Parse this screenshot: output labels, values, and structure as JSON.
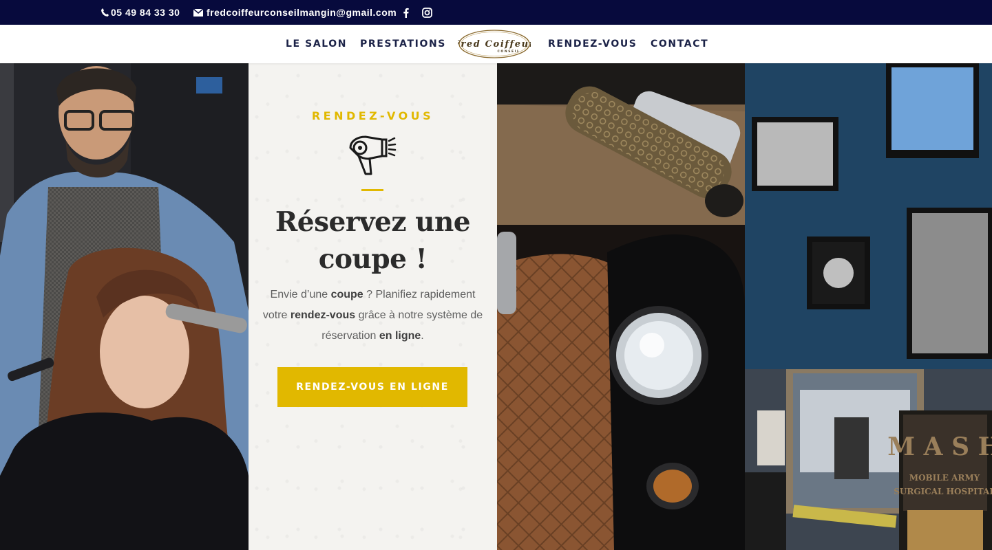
{
  "topbar": {
    "phone": "05 49 84 33 30",
    "email": "fredcoiffeurconseilmangin@gmail.com"
  },
  "nav": {
    "items": [
      {
        "label": "LE SALON"
      },
      {
        "label": "PRESTATIONS"
      },
      {
        "label": "RENDEZ-VOUS"
      },
      {
        "label": "CONTACT"
      }
    ],
    "logo": {
      "text_main": "Fred Coiffeur",
      "text_sub": "CONSEIL"
    }
  },
  "hero": {
    "kicker": "RENDEZ-VOUS",
    "headline_line1": "Réservez une",
    "headline_line2": "coupe !",
    "body": {
      "t1": "Envie d’une ",
      "b1": "coupe",
      "t2": " ? Planifiez rapidement votre ",
      "b2": "rendez-vous",
      "t3": " grâce à notre système de réservation ",
      "b3": "en ligne",
      "t4": "."
    },
    "cta_label": "RENDEZ-VOUS EN LIGNE"
  },
  "photos": {
    "mash_line1": "M A S H",
    "mash_line2": "MOBILE ARMY",
    "mash_line3": "SURGICAL HOSPITAL"
  },
  "colors": {
    "topbar_bg": "#070a3d",
    "accent": "#e1b800",
    "nav_text": "#1b2247",
    "wall_blue": "#1d4260"
  },
  "icons": {
    "phone": "phone-icon",
    "email": "envelope-icon",
    "facebook": "facebook-icon",
    "instagram": "instagram-icon",
    "hero": "hair-dryer-icon"
  }
}
